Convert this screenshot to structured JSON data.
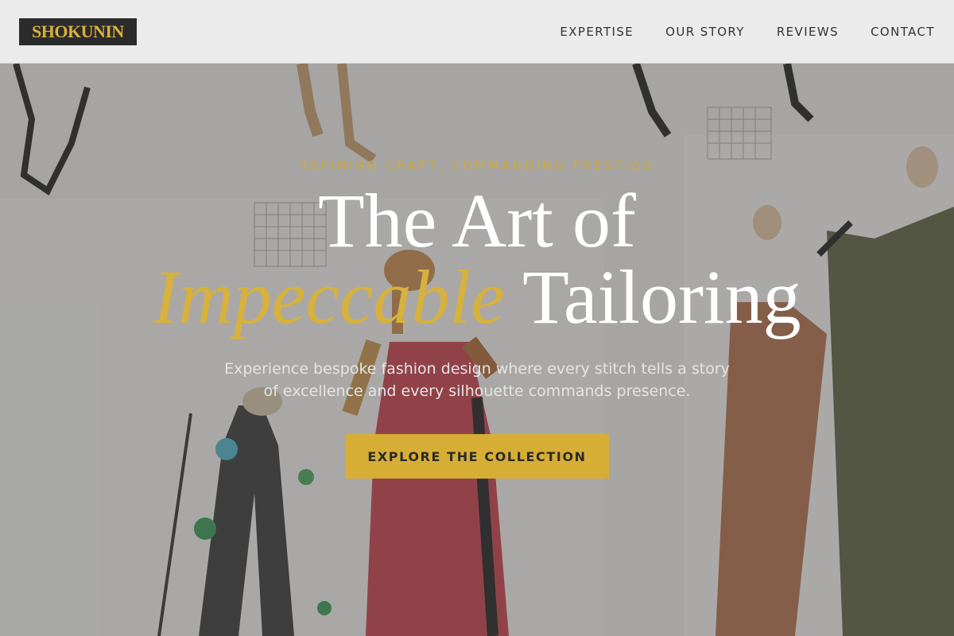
{
  "header": {
    "logo_text": "SHOKUNIN",
    "nav": [
      {
        "label": "EXPERTISE"
      },
      {
        "label": "OUR STORY"
      },
      {
        "label": "REVIEWS"
      },
      {
        "label": "CONTACT"
      }
    ]
  },
  "hero": {
    "eyebrow": "REFINING CRAFT, COMMANDING PRESTIGE",
    "headline_line1": "The Art of",
    "headline_accent": "Impeccable",
    "headline_line2_rest": "Tailoring",
    "subhead": "Experience bespoke fashion design where every stitch tells a story of excellence and every silhouette commands presence.",
    "cta_label": "EXPLORE THE COLLECTION"
  },
  "colors": {
    "accent_gold": "#d6ae35",
    "logo_bg": "#2b2b2b",
    "header_bg": "#f0f0f0"
  }
}
